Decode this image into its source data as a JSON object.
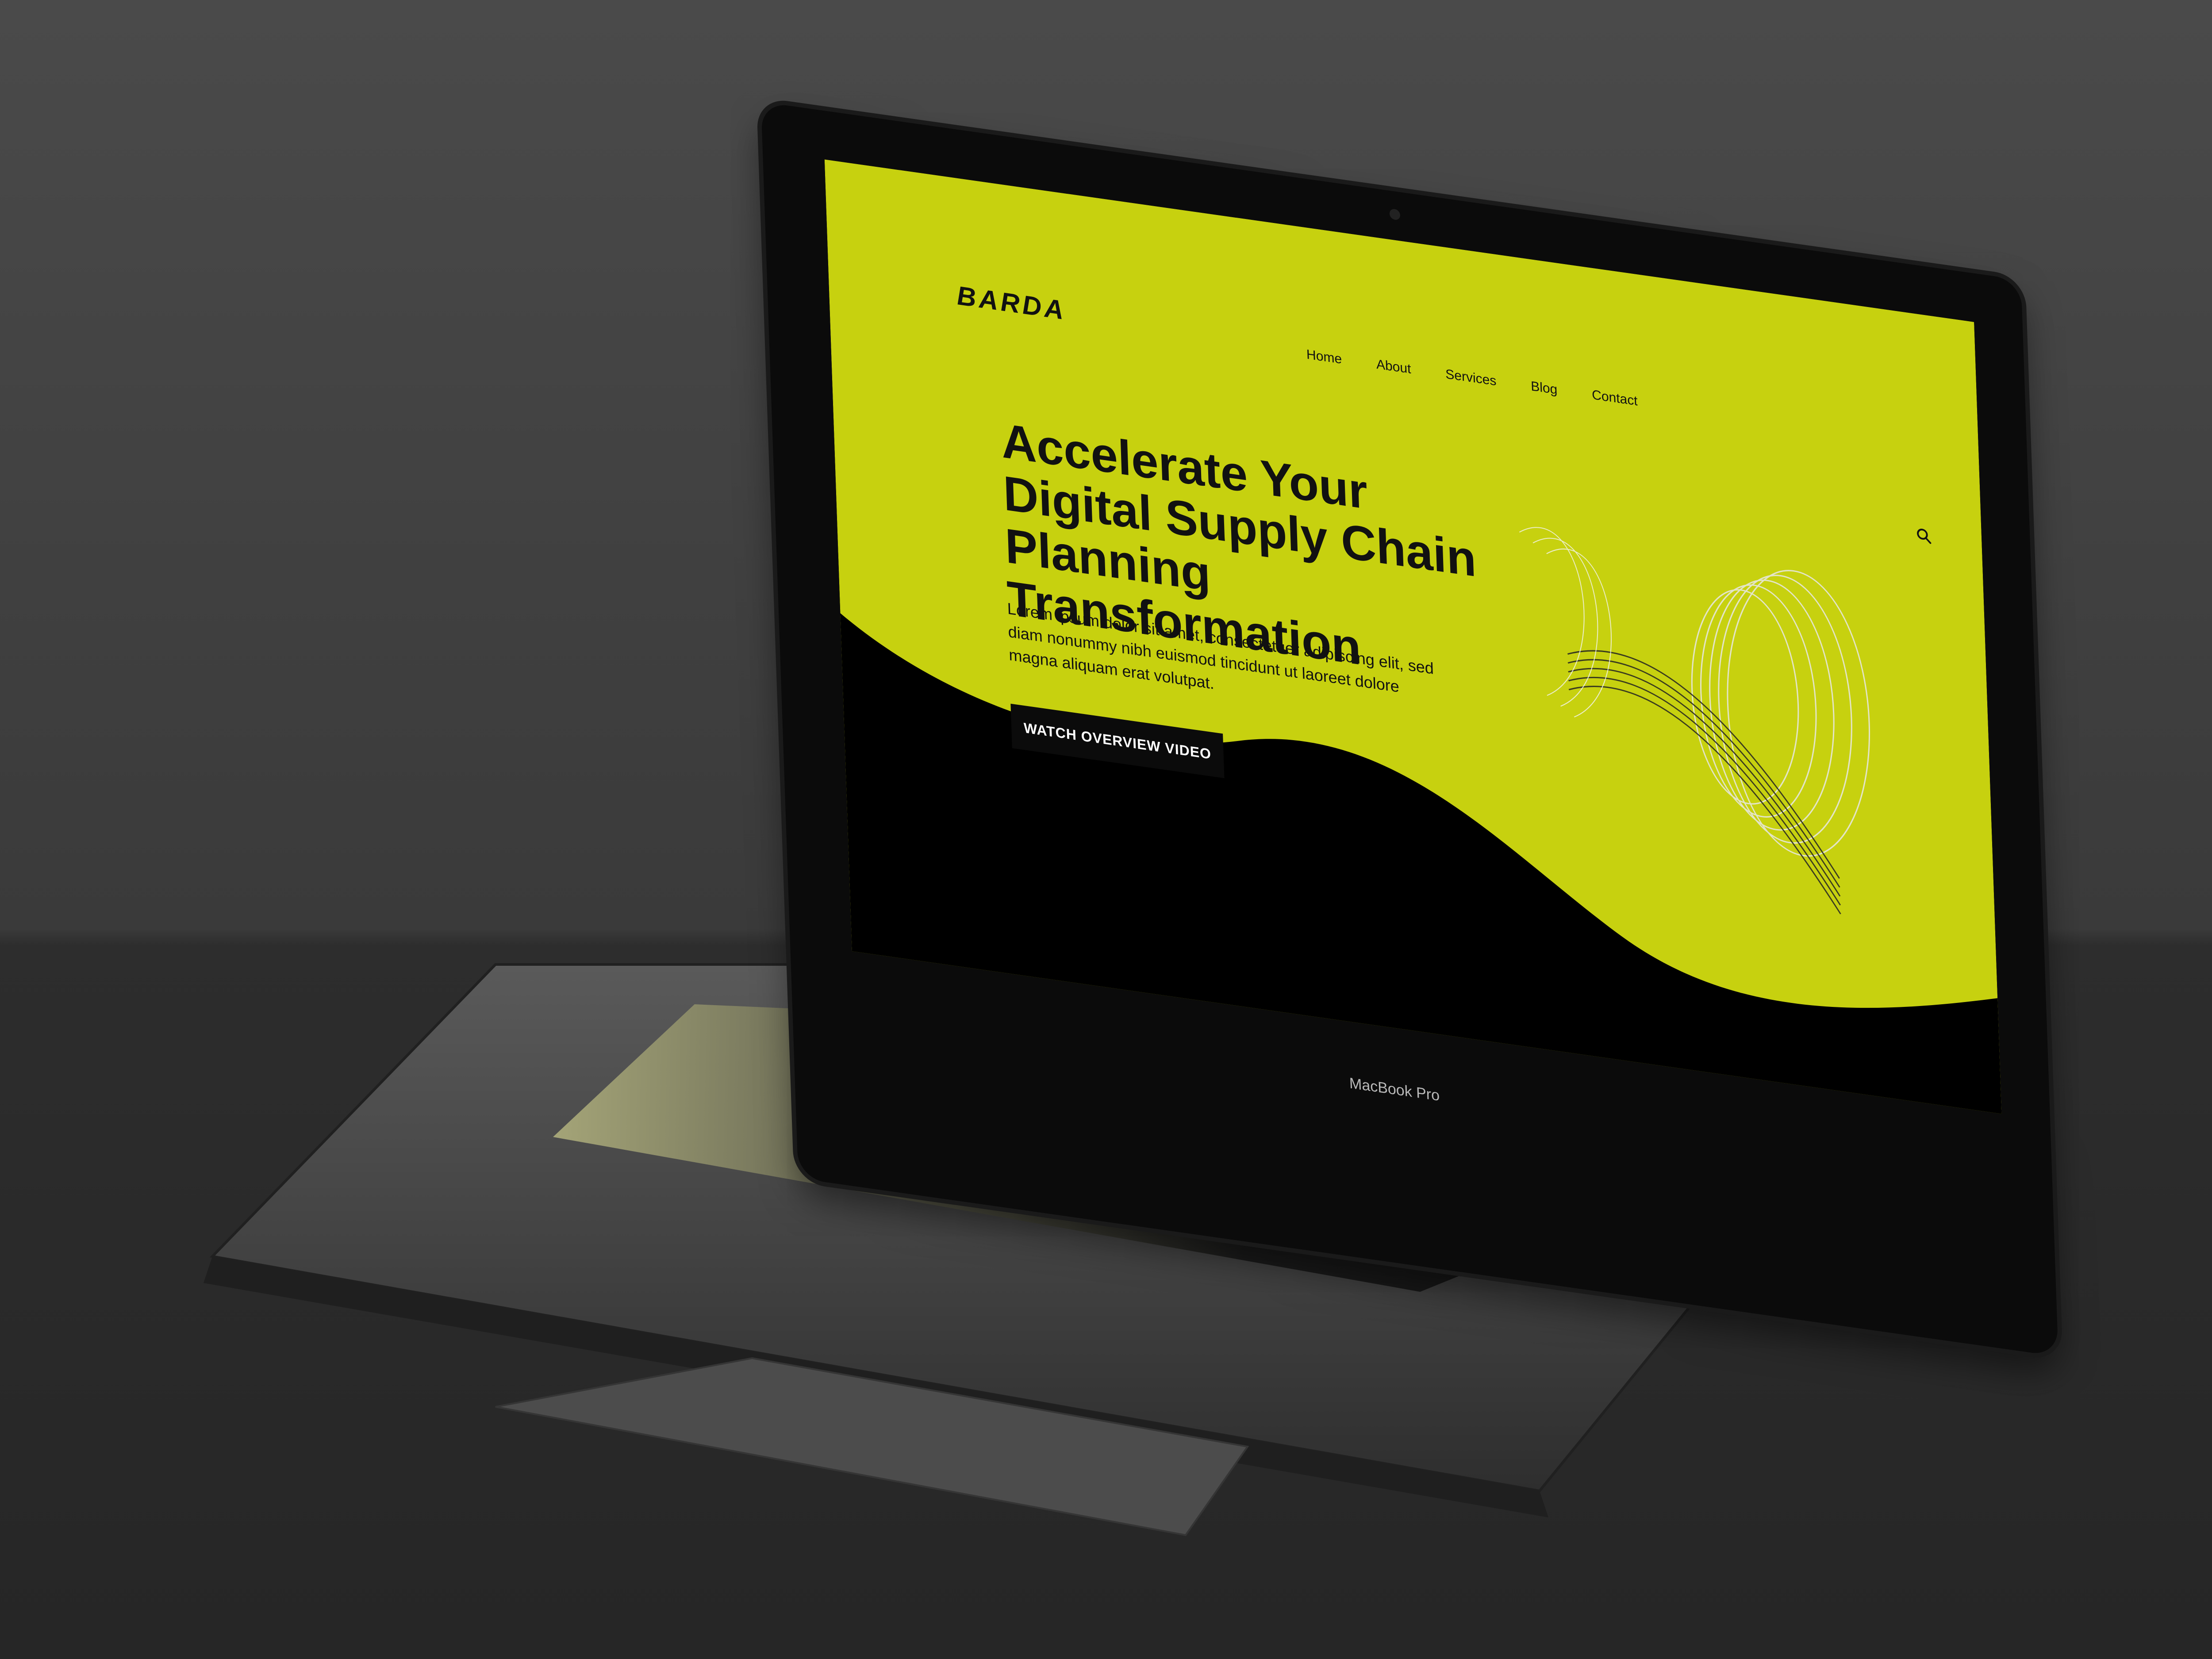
{
  "brand": {
    "logo": "BARDA"
  },
  "nav": {
    "items": [
      "Home",
      "About",
      "Services",
      "Blog",
      "Contact"
    ]
  },
  "hero": {
    "title": "Accelerate Your Digital Supply Chain Planning Transformation",
    "body": "Lorem ipsum dolor sit amet, consectetuer adipiscing elit, sed diam nonummy nibh euismod tincidunt ut laoreet dolore magna aliquam erat volutpat.",
    "cta_label": "WATCH OVERVIEW VIDEO"
  },
  "device": {
    "label": "MacBook Pro"
  },
  "colors": {
    "accent": "#c7d10f",
    "dark": "#0b0b0b",
    "background": "#3f3f3f"
  },
  "icons": {
    "search": "search-icon"
  }
}
